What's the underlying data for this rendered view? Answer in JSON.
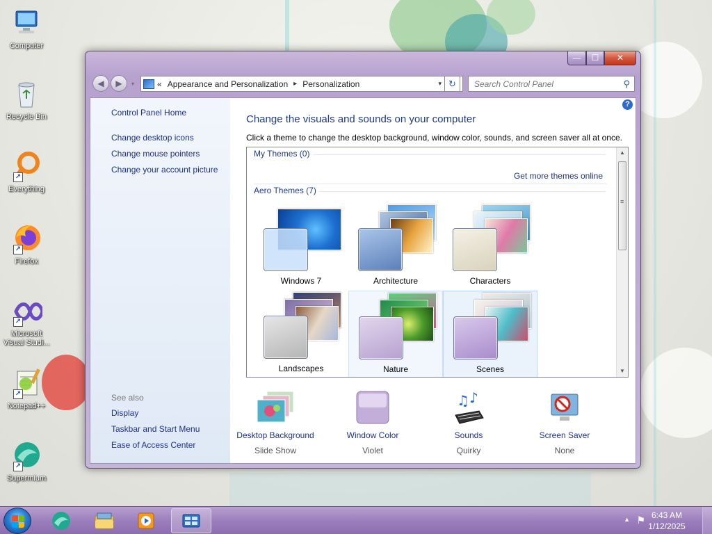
{
  "desktop": {
    "icons": [
      {
        "label": "Computer",
        "icon": "computer-icon",
        "shortcut": false
      },
      {
        "label": "Recycle Bin",
        "icon": "recycle-bin-icon",
        "shortcut": false
      },
      {
        "label": "Everything",
        "icon": "everything-icon",
        "shortcut": true
      },
      {
        "label": "Firefox",
        "icon": "firefox-icon",
        "shortcut": true
      },
      {
        "label": "Microsoft Visual Studi...",
        "icon": "visual-studio-icon",
        "shortcut": true
      },
      {
        "label": "Notepad++",
        "icon": "notepadplusplus-icon",
        "shortcut": true
      },
      {
        "label": "Supermium",
        "icon": "supermium-icon",
        "shortcut": true
      }
    ]
  },
  "window": {
    "controls": {
      "minimize": "—",
      "maximize": "☐",
      "close": "✕"
    },
    "nav": {
      "back": "◀",
      "forward": "▶",
      "history_dropdown": "▾"
    },
    "address": {
      "overflow": "«",
      "crumbs": [
        "Appearance and Personalization",
        "Personalization"
      ],
      "separator": "▸",
      "dropdown": "▾"
    },
    "refresh": "↻",
    "search": {
      "placeholder": "Search Control Panel",
      "icon": "search-icon"
    },
    "sidebar": {
      "home": "Control Panel Home",
      "tasks": [
        "Change desktop icons",
        "Change mouse pointers",
        "Change your account picture"
      ],
      "see_also_title": "See also",
      "see_also": [
        "Display",
        "Taskbar and Start Menu",
        "Ease of Access Center"
      ]
    },
    "main": {
      "help": "?",
      "heading": "Change the visuals and sounds on your computer",
      "subtitle": "Click a theme to change the desktop background, window color, sounds, and screen saver all at once.",
      "my_themes": "My Themes (0)",
      "get_more": "Get more themes online",
      "aero_themes": "Aero Themes (7)",
      "themes": [
        {
          "name": "Windows 7",
          "state": "normal"
        },
        {
          "name": "Architecture",
          "state": "normal"
        },
        {
          "name": "Characters",
          "state": "normal"
        },
        {
          "name": "Landscapes",
          "state": "normal"
        },
        {
          "name": "Nature",
          "state": "hover"
        },
        {
          "name": "Scenes",
          "state": "selected"
        }
      ],
      "options": [
        {
          "link": "Desktop Background",
          "value": "Slide Show",
          "icon": "desktop-background-icon"
        },
        {
          "link": "Window Color",
          "value": "Violet",
          "icon": "window-color-icon"
        },
        {
          "link": "Sounds",
          "value": "Quirky",
          "icon": "sounds-icon"
        },
        {
          "link": "Screen Saver",
          "value": "None",
          "icon": "screen-saver-icon"
        }
      ]
    }
  },
  "taskbar": {
    "pinned": [
      "supermium-icon",
      "windows-explorer-icon",
      "media-player-icon",
      "control-panel-icon"
    ],
    "tray": {
      "arrow": "▲",
      "flag": "⚑",
      "time": "6:43 AM",
      "date": "1/12/2025"
    }
  },
  "colors": {
    "link": "#1e3287",
    "heading": "#1e3a8a",
    "glass": "#b7a1cf",
    "taskbar": "#9c7fbd"
  }
}
